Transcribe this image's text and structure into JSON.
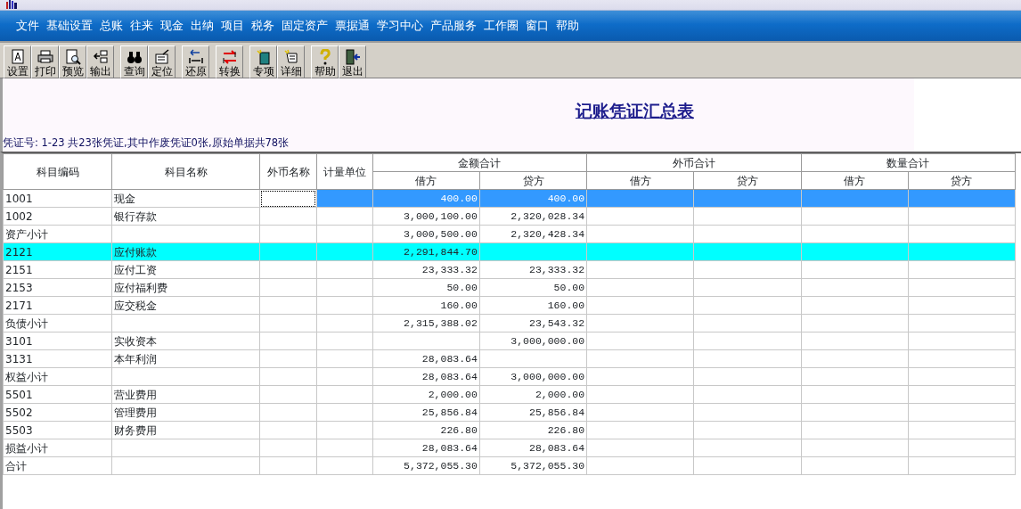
{
  "menu": [
    "文件",
    "基础设置",
    "总账",
    "往来",
    "现金",
    "出纳",
    "项目",
    "税务",
    "固定资产",
    "票据通",
    "学习中心",
    "产品服务",
    "工作圈",
    "窗口",
    "帮助"
  ],
  "toolbar_groups": [
    {
      "buttons": [
        "设置",
        "打印",
        "预览",
        "输出"
      ]
    },
    {
      "buttons": [
        "查询",
        "定位"
      ]
    },
    {
      "buttons": [
        "还原"
      ]
    },
    {
      "buttons": [
        "转换"
      ]
    },
    {
      "buttons": [
        "专项",
        "详细"
      ]
    },
    {
      "buttons": [
        "帮助",
        "退出"
      ]
    }
  ],
  "report": {
    "title": "记账凭证汇总表",
    "summary": "凭证号: 1-23 共23张凭证,其中作废凭证0张,原始单据共78张"
  },
  "table": {
    "columns": [
      {
        "label": "科目编码"
      },
      {
        "label": "科目名称"
      },
      {
        "label": "外币名称"
      },
      {
        "label": "计量单位"
      },
      {
        "label": "金额合计",
        "children": [
          "借方",
          "贷方"
        ]
      },
      {
        "label": "外币合计",
        "children": [
          "借方",
          "贷方"
        ]
      },
      {
        "label": "数量合计",
        "children": [
          "借方",
          "贷方"
        ]
      }
    ],
    "rows": [
      {
        "code": "1001",
        "name": "现金",
        "debit": "400.00",
        "credit": "400.00",
        "selected": true,
        "highlighted": false
      },
      {
        "code": "1002",
        "name": "银行存款",
        "debit": "3,000,100.00",
        "credit": "2,320,028.34",
        "selected": false,
        "highlighted": false
      },
      {
        "code": "资产小计",
        "debit": "3,000,500.00",
        "credit": "2,320,428.34",
        "selected": false,
        "highlighted": false
      },
      {
        "code": "2121",
        "name": "应付账款",
        "debit": "2,291,844.70",
        "selected": false,
        "highlighted": true
      },
      {
        "code": "2151",
        "name": "应付工资",
        "debit": "23,333.32",
        "credit": "23,333.32",
        "selected": false,
        "highlighted": false
      },
      {
        "code": "2153",
        "name": "应付福利费",
        "debit": "50.00",
        "credit": "50.00",
        "selected": false,
        "highlighted": false
      },
      {
        "code": "2171",
        "name": "应交税金",
        "debit": "160.00",
        "credit": "160.00",
        "selected": false,
        "highlighted": false
      },
      {
        "code": "负债小计",
        "debit": "2,315,388.02",
        "credit": "23,543.32",
        "selected": false,
        "highlighted": false
      },
      {
        "code": "3101",
        "name": "实收资本",
        "credit": "3,000,000.00",
        "selected": false,
        "highlighted": false
      },
      {
        "code": "3131",
        "name": "本年利润",
        "debit": "28,083.64",
        "selected": false,
        "highlighted": false
      },
      {
        "code": "权益小计",
        "debit": "28,083.64",
        "credit": "3,000,000.00",
        "selected": false,
        "highlighted": false
      },
      {
        "code": "5501",
        "name": "营业费用",
        "debit": "2,000.00",
        "credit": "2,000.00",
        "selected": false,
        "highlighted": false
      },
      {
        "code": "5502",
        "name": "管理费用",
        "debit": "25,856.84",
        "credit": "25,856.84",
        "selected": false,
        "highlighted": false
      },
      {
        "code": "5503",
        "name": "财务费用",
        "debit": "226.80",
        "credit": "226.80",
        "selected": false,
        "highlighted": false
      },
      {
        "code": "损益小计",
        "debit": "28,083.64",
        "credit": "28,083.64",
        "selected": false,
        "highlighted": false
      },
      {
        "code": "合计",
        "debit": "5,372,055.30",
        "credit": "5,372,055.30",
        "selected": false,
        "highlighted": false
      }
    ]
  }
}
